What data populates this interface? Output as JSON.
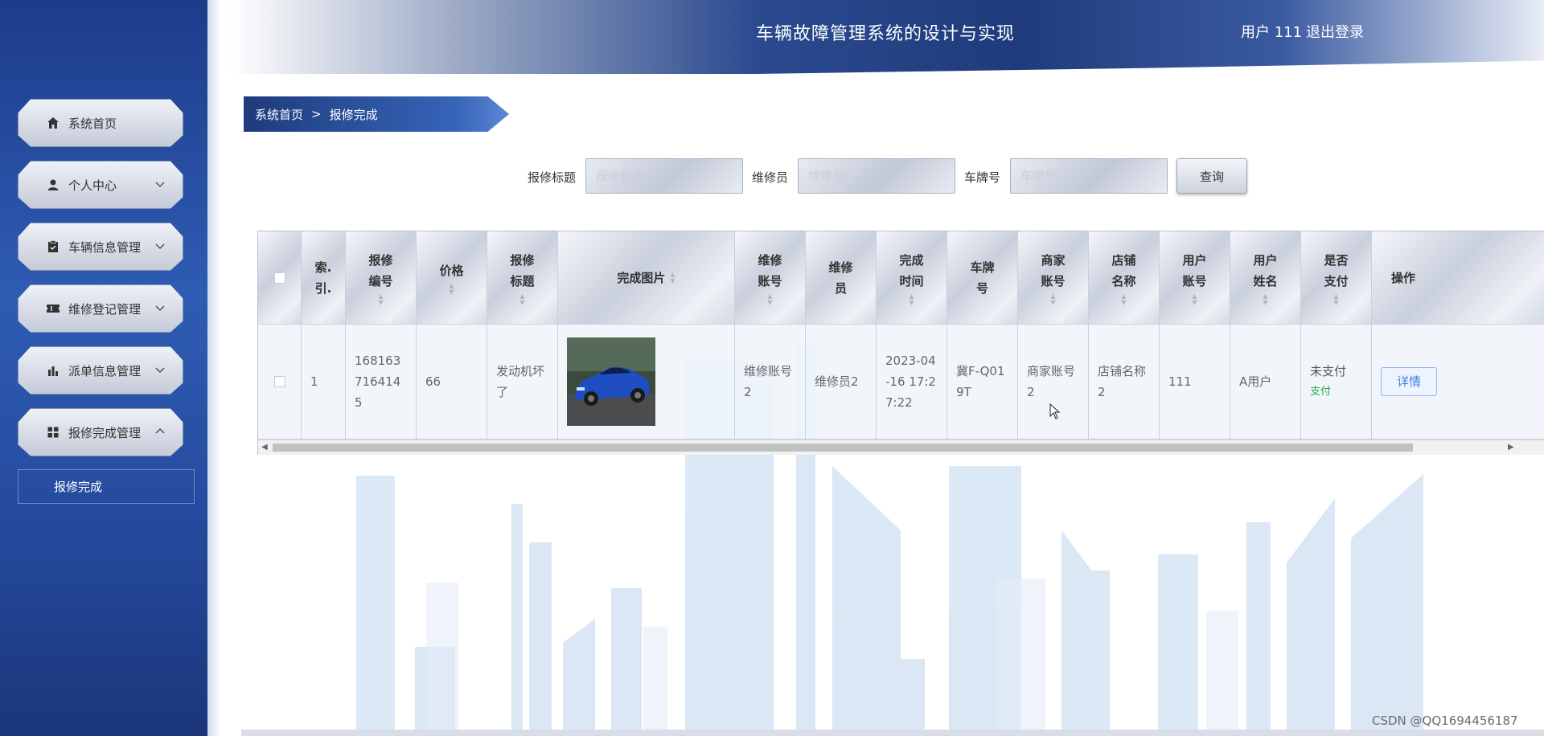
{
  "header": {
    "title": "车辆故障管理系统的设计与实现",
    "user": "用户 111",
    "logout": "退出登录"
  },
  "sidebar": {
    "items": [
      {
        "label": "系统首页",
        "icon": "home-icon",
        "expandable": false
      },
      {
        "label": "个人中心",
        "icon": "person-icon",
        "expandable": true,
        "expanded": false
      },
      {
        "label": "车辆信息管理",
        "icon": "clipboard-icon",
        "expandable": true,
        "expanded": false
      },
      {
        "label": "维修登记管理",
        "icon": "ticket-icon",
        "expandable": true,
        "expanded": false
      },
      {
        "label": "派单信息管理",
        "icon": "bar-chart-icon",
        "expandable": true,
        "expanded": false
      },
      {
        "label": "报修完成管理",
        "icon": "grid-icon",
        "expandable": true,
        "expanded": true
      }
    ],
    "submenu": {
      "label": "报修完成"
    }
  },
  "breadcrumb": {
    "home": "系统首页",
    "separator": ">",
    "current": "报修完成"
  },
  "search": {
    "title_label": "报修标题",
    "title_placeholder": "报修标题",
    "repairer_label": "维修员",
    "repairer_placeholder": "维修员",
    "plate_label": "车牌号",
    "plate_placeholder": "车牌号",
    "query_label": "查询"
  },
  "table": {
    "headers": {
      "index": "索.\n引.",
      "repair_no": "报修\n编号",
      "price": "价格",
      "repair_title": "报修\n标题",
      "image": "完成图片",
      "repairer_account": "维修\n账号",
      "repairer": "维修\n员",
      "finish_time": "完成\n时间",
      "plate": "车牌\n号",
      "merchant_account": "商家\n账号",
      "shop_name": "店铺\n名称",
      "user_account": "用户\n账号",
      "user_name": "用户\n姓名",
      "paid": "是否\n支付",
      "action": "操作"
    },
    "rows": [
      {
        "index": "1",
        "repair_no": "1681637164145",
        "price": "66",
        "repair_title": "发动机坏了",
        "repairer_account": "维修账号2",
        "repairer": "维修员2",
        "finish_time": "2023-04-16 17:27:22",
        "plate": "冀F-Q019T",
        "merchant_account": "商家账号2",
        "shop_name": "店铺名称2",
        "user_account": "111",
        "user_name": "A用户",
        "paid_status": "未支付",
        "pay_link": "支付",
        "detail_button": "详情"
      }
    ]
  },
  "watermark": "CSDN @QQ1694456187",
  "colors": {
    "sidebar": "#2a52a8",
    "header_dark": "#1f3b7c",
    "pay_link": "#2aa74b",
    "detail_button": "#3b82e0"
  }
}
